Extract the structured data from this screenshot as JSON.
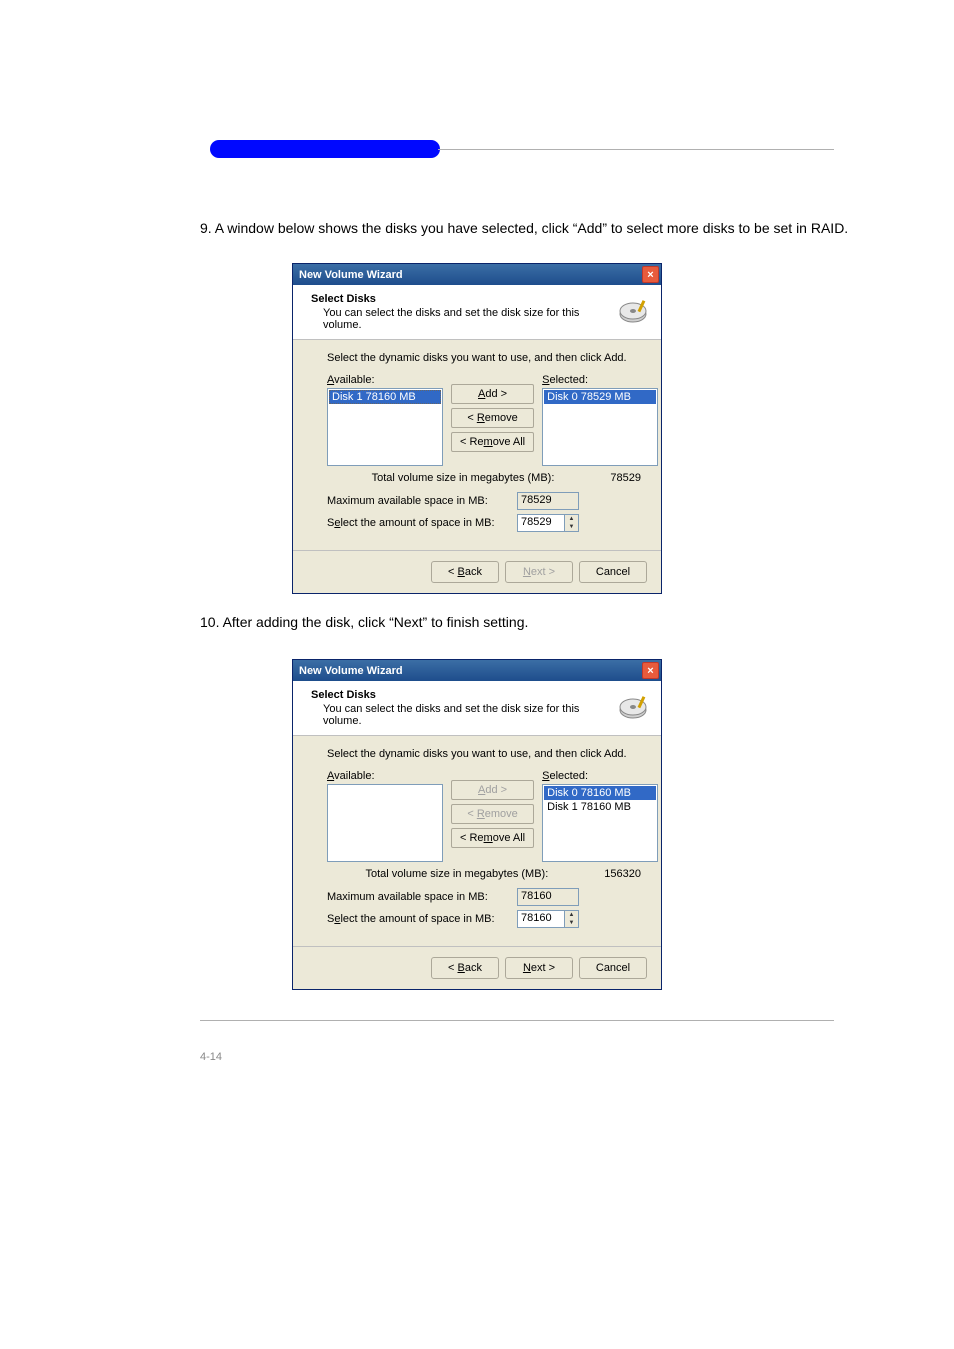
{
  "page": {
    "intro": "9. A window below shows the disks you have selected, click “Add” to select more disks to be set in RAID.",
    "caption1": "10. After adding the disk, click “Next” to finish setting.",
    "footer_page": "4-14"
  },
  "dialog_shared": {
    "title": "New Volume Wizard",
    "close": "×",
    "header_title": "Select Disks",
    "header_subtitle": "You can select the disks and set the disk size for this volume.",
    "instruction": "Select the dynamic disks you want to use, and then click Add.",
    "available_label": "Available:",
    "selected_label": "Selected:",
    "add": "Add >",
    "remove": "< Remove",
    "remove_all": "< Remove All",
    "total_label": "Total volume size in megabytes (MB):",
    "max_label": "Maximum available space in MB:",
    "amount_label": "Select the amount of space in MB:",
    "back": "< Back",
    "next": "Next >",
    "cancel": "Cancel"
  },
  "dialog1": {
    "available_items": [
      "Disk 1      78160 MB"
    ],
    "selected_items": [
      "Disk 0      78529 MB"
    ],
    "total_value": "78529",
    "max_value": "78529",
    "amount_value": "78529",
    "next_disabled": true,
    "add_disabled": false,
    "remove_disabled": false
  },
  "dialog2": {
    "available_items": [],
    "selected_items": [
      "Disk 0      78160 MB",
      "Disk 1      78160 MB"
    ],
    "total_value": "156320",
    "max_value": "78160",
    "amount_value": "78160",
    "next_disabled": false,
    "add_disabled": true,
    "remove_disabled": true
  }
}
